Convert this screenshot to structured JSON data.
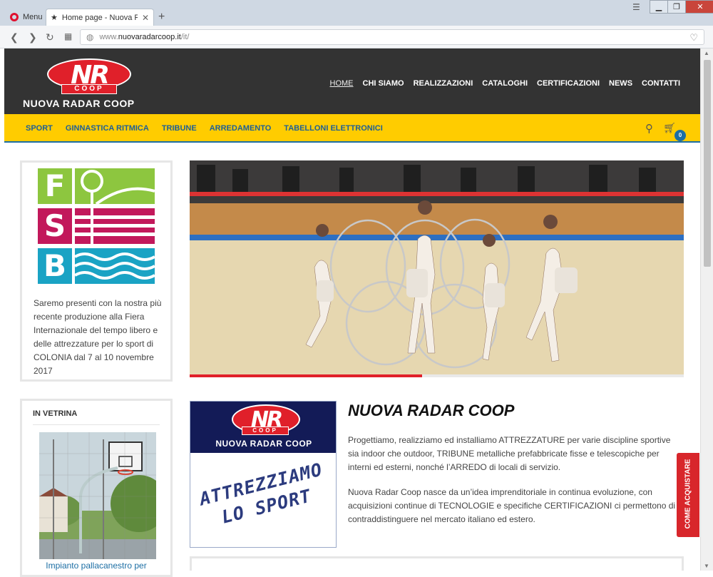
{
  "browser": {
    "menu_label": "Menu",
    "tab_title": "Home page - Nuova Rada",
    "url_scheme": "www.",
    "url_host": "nuovaradarcoop.it",
    "url_path": "/it/"
  },
  "header": {
    "logo_mark": "NR",
    "logo_coop": "COOP",
    "logo_text": "NUOVA RADAR COOP",
    "nav": [
      "HOME",
      "CHI SIAMO",
      "REALIZZAZIONI",
      "CATALOGHI",
      "CERTIFICAZIONI",
      "NEWS",
      "CONTATTI"
    ]
  },
  "catbar": {
    "items": [
      "SPORT",
      "GINNASTICA RITMICA",
      "TRIBUNE",
      "ARREDAMENTO",
      "TABELLONI ELETTRONICI"
    ],
    "cart_count": "0"
  },
  "sidebar": {
    "fsb_letters": [
      "F",
      "S",
      "B"
    ],
    "fair_text": "Saremo presenti con la nostra più recente produzione alla Fiera Internazionale del tempo libero e delle attrezzature per lo sport di COLONIA dal 7 al 10 novembre 2017",
    "vetrina_title": "IN VETRINA",
    "vetrina_caption": "Impianto pallacanestro per"
  },
  "hero": {
    "progress": 0.47
  },
  "promo": {
    "logo_mark": "NR",
    "logo_coop": "COOP",
    "name": "NUOVA RADAR COOP",
    "slogan_line1": "ATTREZZIAMO",
    "slogan_line2": "LO SPORT"
  },
  "main": {
    "title": "NUOVA RADAR COOP",
    "p1": "Progettiamo, realizziamo ed installiamo ATTREZZATURE per varie discipline sportive sia indoor che outdoor, TRIBUNE metalliche prefabbricate fisse e telescopiche per interni ed esterni, nonché l’ARREDO di locali di servizio.",
    "p2": "Nuova Radar Coop nasce da un’idea imprenditoriale in continua evoluzione, con acquisizioni continue di TECNOLOGIE e specifiche CERTIFICAZIONI ci permettono di contraddistinguere nel mercato italiano ed estero."
  },
  "floating": {
    "come_acquistare": "COME ACQUISTARE"
  },
  "colors": {
    "brand_red": "#e0202a",
    "brand_yellow": "#ffcc00",
    "brand_blue": "#1c6ea4",
    "header_dark": "#333333"
  }
}
